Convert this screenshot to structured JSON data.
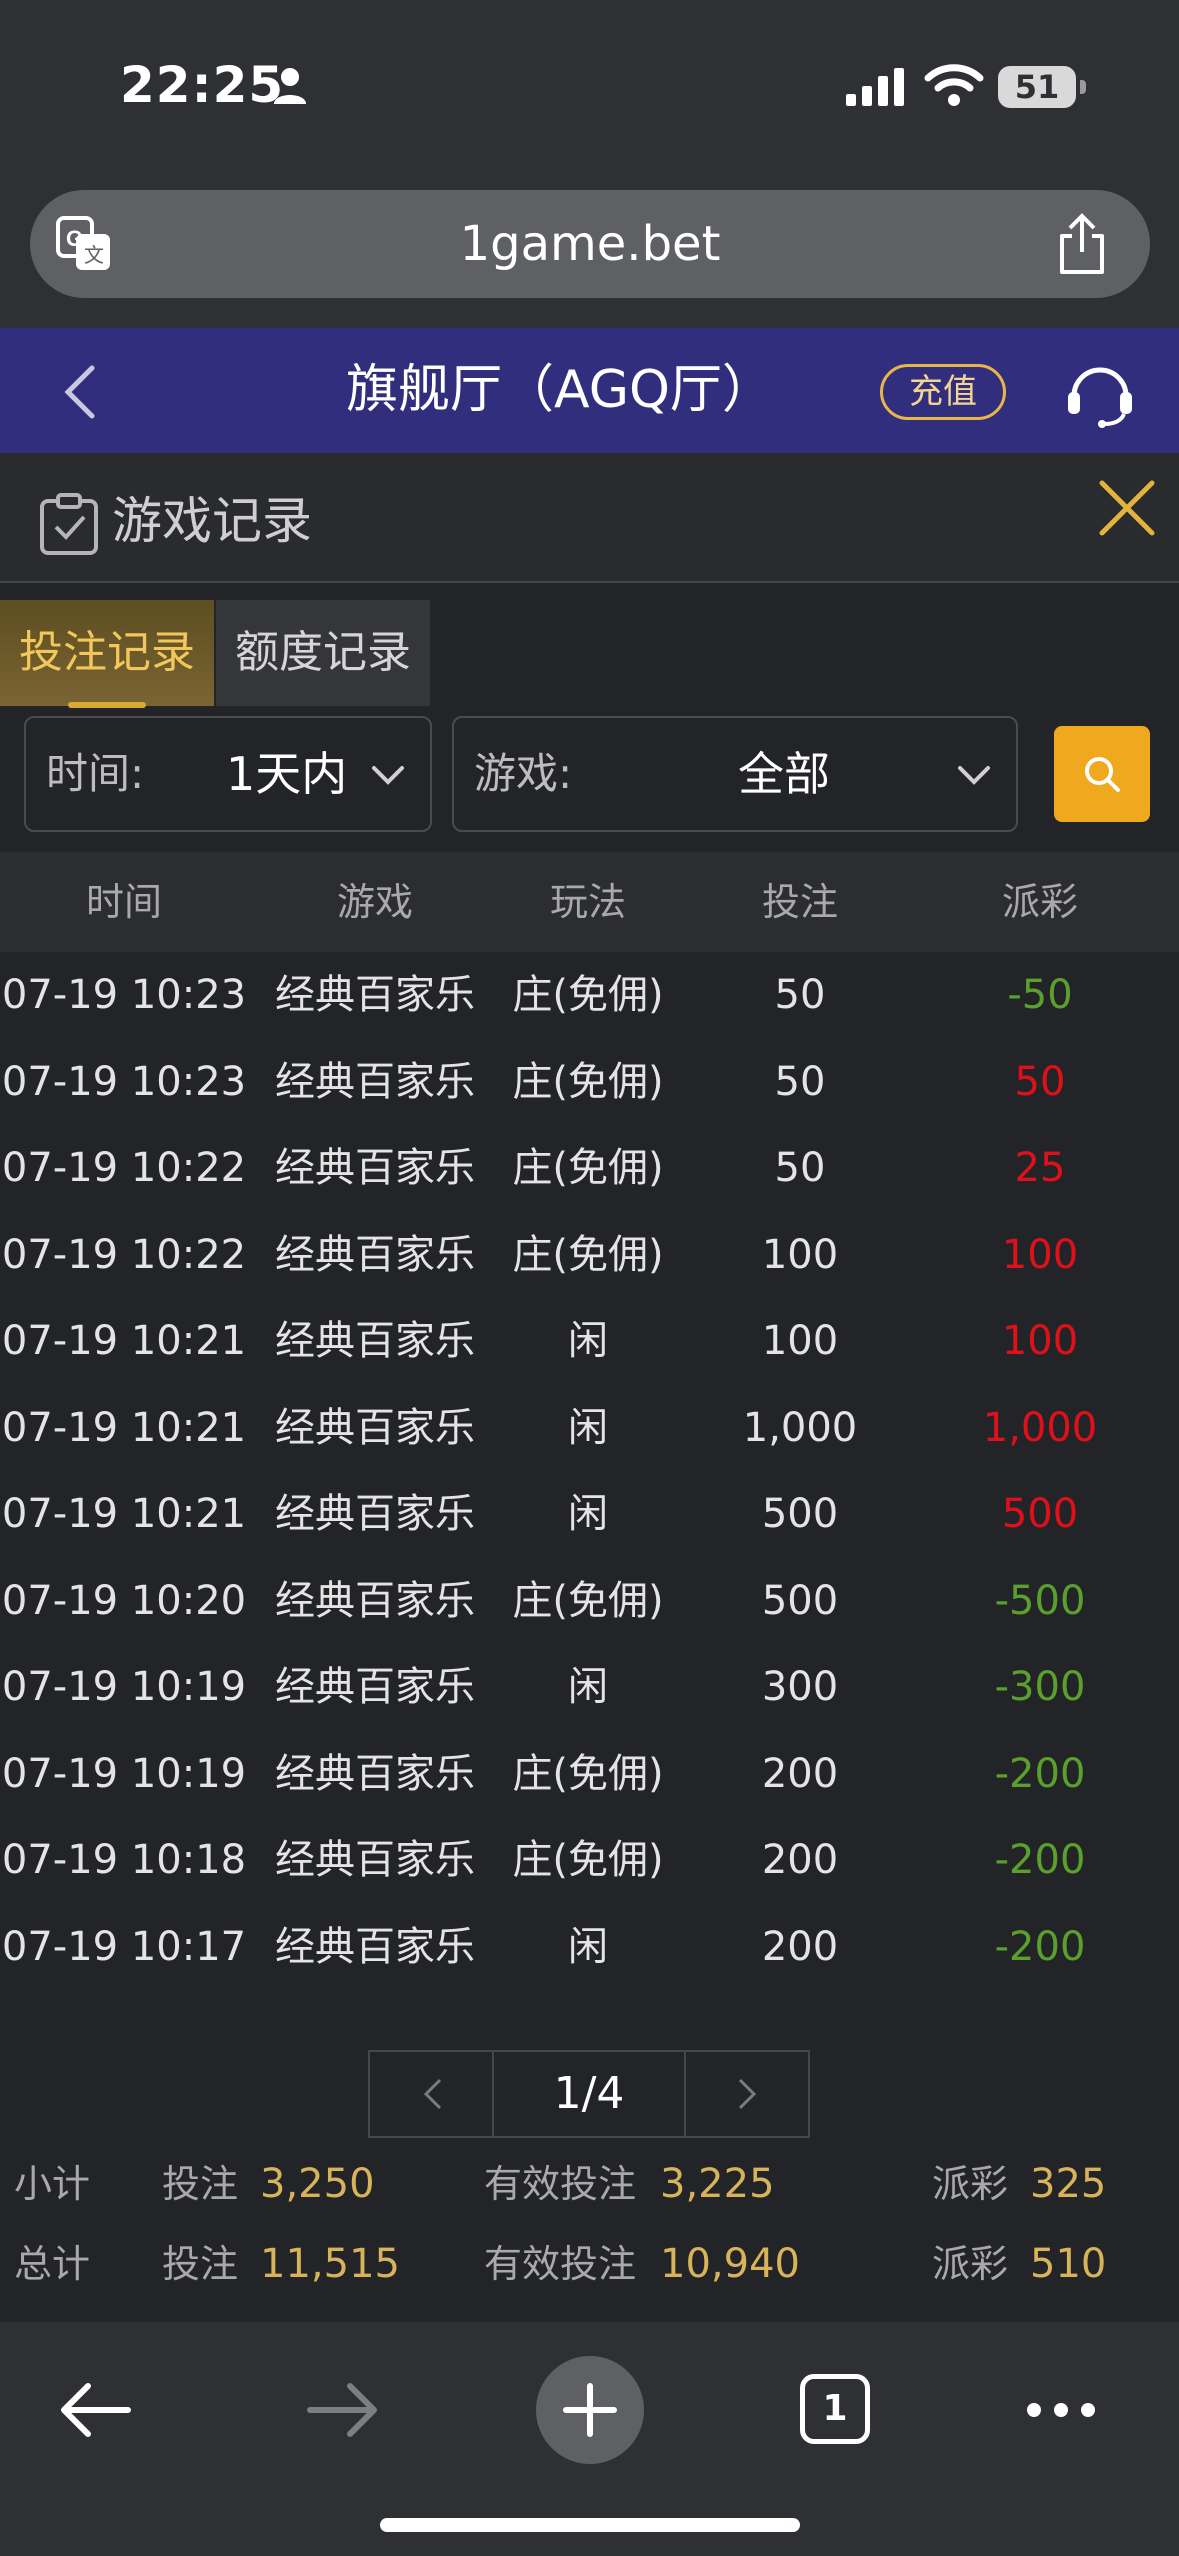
{
  "status_bar": {
    "time": "22:25",
    "battery": "51"
  },
  "browser": {
    "url": "1game.bet"
  },
  "header": {
    "title": "旗舰厅（AGQ厅）",
    "recharge": "充值"
  },
  "panel": {
    "title": "游戏记录"
  },
  "tabs": [
    {
      "label": "投注记录",
      "active": true
    },
    {
      "label": "额度记录",
      "active": false
    }
  ],
  "filters": {
    "time": {
      "label": "时间:",
      "value": "1天内"
    },
    "game": {
      "label": "游戏:",
      "value": "全部"
    }
  },
  "table": {
    "columns": [
      "时间",
      "游戏",
      "玩法",
      "投注",
      "派彩"
    ],
    "rows": [
      {
        "time": "07-19 10:23",
        "game": "经典百家乐",
        "play": "庄(免佣)",
        "bet": "50",
        "payout": "-50",
        "win": false
      },
      {
        "time": "07-19 10:23",
        "game": "经典百家乐",
        "play": "庄(免佣)",
        "bet": "50",
        "payout": "50",
        "win": true
      },
      {
        "time": "07-19 10:22",
        "game": "经典百家乐",
        "play": "庄(免佣)",
        "bet": "50",
        "payout": "25",
        "win": true
      },
      {
        "time": "07-19 10:22",
        "game": "经典百家乐",
        "play": "庄(免佣)",
        "bet": "100",
        "payout": "100",
        "win": true
      },
      {
        "time": "07-19 10:21",
        "game": "经典百家乐",
        "play": "闲",
        "bet": "100",
        "payout": "100",
        "win": true
      },
      {
        "time": "07-19 10:21",
        "game": "经典百家乐",
        "play": "闲",
        "bet": "1,000",
        "payout": "1,000",
        "win": true
      },
      {
        "time": "07-19 10:21",
        "game": "经典百家乐",
        "play": "闲",
        "bet": "500",
        "payout": "500",
        "win": true
      },
      {
        "time": "07-19 10:20",
        "game": "经典百家乐",
        "play": "庄(免佣)",
        "bet": "500",
        "payout": "-500",
        "win": false
      },
      {
        "time": "07-19 10:19",
        "game": "经典百家乐",
        "play": "闲",
        "bet": "300",
        "payout": "-300",
        "win": false
      },
      {
        "time": "07-19 10:19",
        "game": "经典百家乐",
        "play": "庄(免佣)",
        "bet": "200",
        "payout": "-200",
        "win": false
      },
      {
        "time": "07-19 10:18",
        "game": "经典百家乐",
        "play": "庄(免佣)",
        "bet": "200",
        "payout": "-200",
        "win": false
      },
      {
        "time": "07-19 10:17",
        "game": "经典百家乐",
        "play": "闲",
        "bet": "200",
        "payout": "-200",
        "win": false
      }
    ]
  },
  "pagination": {
    "indicator": "1/4"
  },
  "summary": {
    "subtotal": {
      "label": "小计",
      "bet_label": "投注",
      "bet": "3,250",
      "valid_label": "有效投注",
      "valid": "3,225",
      "payout_label": "派彩",
      "payout": "325"
    },
    "total": {
      "label": "总计",
      "bet_label": "投注",
      "bet": "11,515",
      "valid_label": "有效投注",
      "valid": "10,940",
      "payout_label": "派彩",
      "payout": "510"
    }
  },
  "toolbar": {
    "tab_count": "1"
  },
  "colors": {
    "win": "#e0101a",
    "loss": "#5aa02c",
    "accent": "#f0a81f",
    "header_bg": "#322e7e",
    "gold_text": "#d8b35a"
  }
}
